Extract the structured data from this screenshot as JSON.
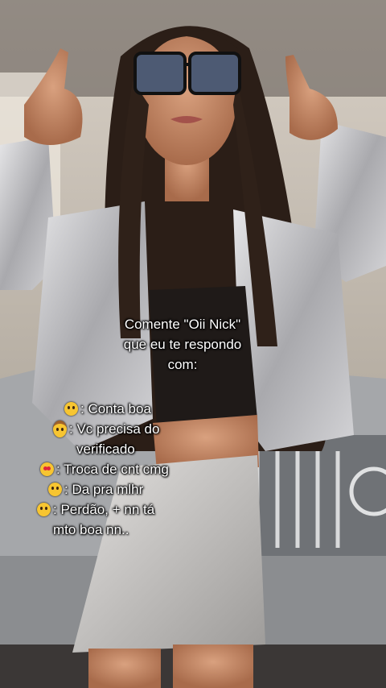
{
  "overlay": {
    "title_lines": [
      "Comente \"Oii Nick\"",
      "que eu te respondo",
      "com:"
    ],
    "options": [
      {
        "icon": "grinning-face-emoji",
        "text": ": Conta boa"
      },
      {
        "icon": "cowboy-face-emoji",
        "text": ": Vc precisa do"
      },
      {
        "icon": "",
        "text": "verificado"
      },
      {
        "icon": "heart-eyes-emoji",
        "text": ": Troca de cnt cmg"
      },
      {
        "icon": "confused-face-emoji",
        "text": ": Da pra mlhr"
      },
      {
        "icon": "disappointed-face-emoji",
        "text": ": Perdão, + nn tá"
      },
      {
        "icon": "",
        "text": "mto boa nn.."
      }
    ]
  },
  "colors": {
    "text": "#ffffff",
    "outline": "#000000",
    "jacket": "#c9c9cc",
    "hair": "#2a1d16",
    "car": "#a9abae",
    "wall": "#d9cfc4"
  }
}
